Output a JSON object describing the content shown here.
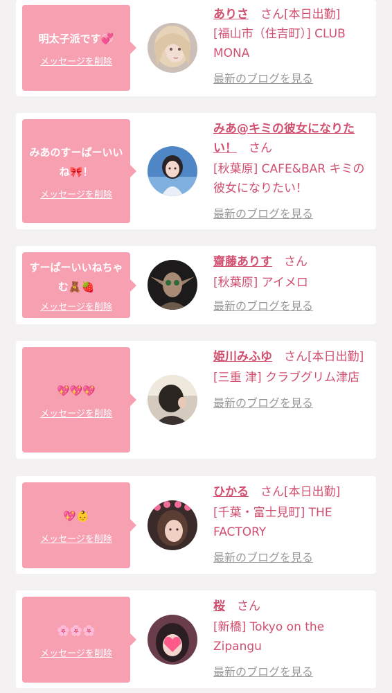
{
  "common": {
    "delete_label": "メッセージを削除",
    "blog_label": "最新のブログを見る"
  },
  "colors": {
    "bubble": "#f7a0b2",
    "accent": "#d14f6e",
    "muted": "#9a9a9a",
    "page_bg": "#f4f1f2"
  },
  "items": [
    {
      "message": "明太子派です💞",
      "name": "ありさ",
      "suffix": "　さん[本日出勤]",
      "shop": "[福山市（住吉町）] CLUB MONA",
      "avatar": "blonde-girl-avatar"
    },
    {
      "message": "みあのすーぱーいいね🎀！",
      "name": "みあ@キミの彼女になりたい！",
      "suffix": "　さん",
      "shop": "[秋葉原] CAFE&BAR キミの彼女になりたい！",
      "avatar": "girl-blue-background-avatar"
    },
    {
      "message": "すーぱーいいねちゃむ🧸🍓",
      "name": "齋藤ありす",
      "suffix": "　さん",
      "shop": "[秋葉原] アイメロ",
      "avatar": "elf-figure-avatar"
    },
    {
      "message": "💖💖💖",
      "name": "姫川みふゆ",
      "suffix": "　さん[本日出勤]",
      "shop": "[三重 津] クラブグリム津店",
      "avatar": "dark-hair-back-avatar"
    },
    {
      "message": "💖👶",
      "name": "ひかる",
      "suffix": "　さん[本日出勤]",
      "shop": "[千葉・富士見町] THE FACTORY",
      "avatar": "girl-heart-crown-avatar"
    },
    {
      "message": "🌸🌸🌸",
      "name": "桜",
      "suffix": "　さん",
      "shop": "[新橋] Tokyo on the Zipangu",
      "avatar": "girl-heart-mask-avatar"
    }
  ]
}
